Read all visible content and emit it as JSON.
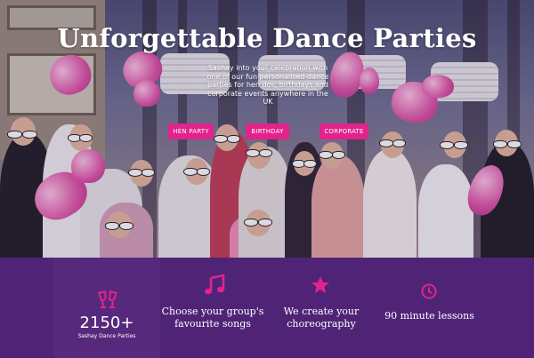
{
  "hero": {
    "title": "Unforgettable Dance Parties",
    "subtitle": "Sashay into your celebration with one of our fun personalised dance parties for hen dos, birthdays and corporate events anywhere in the UK",
    "buttons": [
      {
        "label": "HEN PARTY"
      },
      {
        "label": "BIRTHDAY"
      },
      {
        "label": "CORPORATE"
      }
    ]
  },
  "features": {
    "stat": {
      "icon": "cheers-glasses-icon",
      "number": "2150+",
      "label": "Sashay Dance Parties"
    },
    "items": [
      {
        "icon": "music-note-icon",
        "text_line1": "Choose your group's",
        "text_line2": "favourite songs"
      },
      {
        "icon": "star-icon",
        "text_line1": "We create your",
        "text_line2": "choreography"
      },
      {
        "icon": "clock-icon",
        "text_line1": "90 minute lessons",
        "text_line2": ""
      }
    ]
  },
  "colors": {
    "accent": "#e1238b",
    "band_background": "#4f2476",
    "text": "#ffffff"
  }
}
